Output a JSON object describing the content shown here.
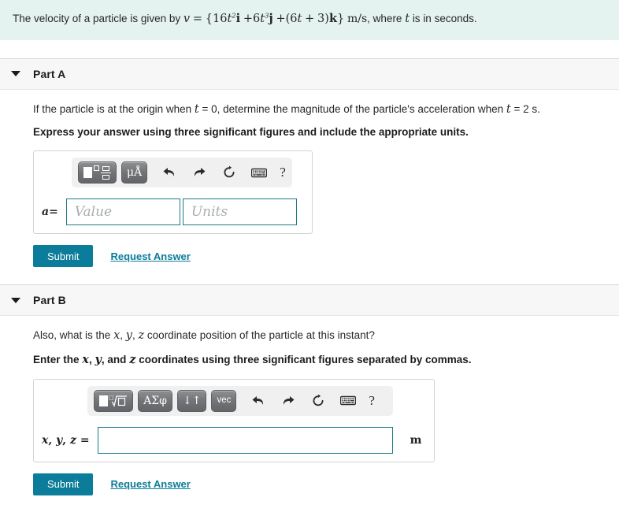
{
  "problem": {
    "prefix": "The velocity of a particle is given by",
    "v_symbol": "v",
    "equals": "=",
    "open_brace": "{",
    "term1_coeff": "16",
    "term1_var": "t",
    "term1_exp": "2",
    "term1_unit": "i",
    "plus1": "+",
    "term2_coeff": "6",
    "term2_var": "t",
    "term2_exp": "3",
    "term2_unit": "j",
    "plus2": "+",
    "term3_open": "(",
    "term3_coeff": "6",
    "term3_var": "t",
    "term3_plus": "+",
    "term3_const": "3",
    "term3_close": ")",
    "term3_unit": "k",
    "close_brace": "}",
    "units": "m/s",
    "suffix_a": ", where",
    "suffix_var": "t",
    "suffix_b": "is in seconds."
  },
  "parts": [
    {
      "title": "Part A",
      "caret": "caret-down-icon",
      "question": {
        "text_1": "If the particle is at the origin when",
        "var_t": "t",
        "text_2": "= 0, determine the magnitude of the particle's acceleration when",
        "var_t2": "t",
        "text_3": "= 2 s."
      },
      "instruction": "Express your answer using three significant figures and include the appropriate units.",
      "toolbar": {
        "buttons": [
          {
            "name": "math-template-button",
            "label": "",
            "kind": "sq-frac"
          },
          {
            "name": "units-button",
            "label": "μÅ",
            "kind": "text"
          }
        ],
        "icons": [
          {
            "name": "undo-icon",
            "glyph": "undo"
          },
          {
            "name": "redo-icon",
            "glyph": "redo"
          },
          {
            "name": "reset-icon",
            "glyph": "reset"
          },
          {
            "name": "keyboard-icon",
            "glyph": "keyboard"
          }
        ],
        "help_label": "?"
      },
      "answer": {
        "var_label": "a",
        "equals": "=",
        "value_placeholder": "Value",
        "units_placeholder": "Units",
        "value": "",
        "units": ""
      },
      "submit_label": "Submit",
      "request_label": "Request Answer"
    },
    {
      "title": "Part B",
      "caret": "caret-down-icon",
      "question": {
        "text_1": "Also, what is the",
        "var_x": "x",
        "comma1": ",",
        "var_y": "y",
        "comma2": ",",
        "var_z": "z",
        "text_2": "coordinate position of the particle at this instant?"
      },
      "instruction": {
        "text_1": "Enter the",
        "var_x": "x",
        "comma1": ",",
        "var_y": "y",
        "text_and": ", and",
        "var_z": "z",
        "text_2": "coordinates using three significant figures separated by commas."
      },
      "toolbar": {
        "buttons": [
          {
            "name": "math-template-button",
            "label": "",
            "kind": "sq-root"
          },
          {
            "name": "greek-letters-button",
            "label": "ΑΣφ",
            "kind": "text"
          },
          {
            "name": "arrows-button",
            "label": "↓↑",
            "kind": "text"
          },
          {
            "name": "vector-button",
            "label": "vec",
            "kind": "text-sans"
          }
        ],
        "icons": [
          {
            "name": "undo-icon",
            "glyph": "undo"
          },
          {
            "name": "redo-icon",
            "glyph": "redo"
          },
          {
            "name": "reset-icon",
            "glyph": "reset"
          },
          {
            "name": "keyboard-icon",
            "glyph": "keyboard"
          }
        ],
        "help_label": "?"
      },
      "answer": {
        "var_label_x": "x",
        "var_label_y": "y",
        "var_label_z": "z",
        "comma": ",",
        "equals": "=",
        "value": "",
        "placeholder": "",
        "unit_suffix": "m"
      },
      "submit_label": "Submit",
      "request_label": "Request Answer"
    }
  ],
  "colors": {
    "statement_bg": "#e4f2f0",
    "part_header_bg": "#f7f7f7",
    "submit_bg": "#0b7c99",
    "link": "#0b7c99",
    "input_border": "#1a7b88",
    "toolbar_bg": "#f0f0f0",
    "tool_button": "#727477"
  }
}
